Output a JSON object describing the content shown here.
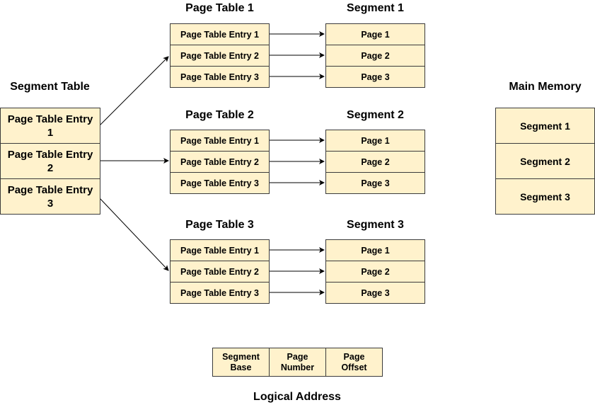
{
  "segment_table": {
    "title": "Segment Table",
    "entries": [
      "Page Table Entry 1",
      "Page Table Entry 2",
      "Page Table Entry 3"
    ]
  },
  "page_tables": [
    {
      "title": "Page Table 1",
      "entries": [
        "Page Table Entry 1",
        "Page Table Entry 2",
        "Page Table Entry 3"
      ]
    },
    {
      "title": "Page Table 2",
      "entries": [
        "Page Table Entry 1",
        "Page Table Entry 2",
        "Page Table Entry 3"
      ]
    },
    {
      "title": "Page Table 3",
      "entries": [
        "Page Table Entry 1",
        "Page Table Entry 2",
        "Page Table Entry 3"
      ]
    }
  ],
  "segments": [
    {
      "title": "Segment 1",
      "pages": [
        "Page 1",
        "Page 2",
        "Page 3"
      ]
    },
    {
      "title": "Segment 2",
      "pages": [
        "Page 1",
        "Page 2",
        "Page 3"
      ]
    },
    {
      "title": "Segment 3",
      "pages": [
        "Page 1",
        "Page 2",
        "Page 3"
      ]
    }
  ],
  "main_memory": {
    "title": "Main Memory",
    "segments": [
      "Segment 1",
      "Segment 2",
      "Segment 3"
    ]
  },
  "logical_address": {
    "title": "Logical Address",
    "fields": [
      "Segment Base",
      "Page Number",
      "Page Offset"
    ]
  },
  "colors": {
    "box_fill": "#fff2cc",
    "border": "#3b3b3b"
  }
}
